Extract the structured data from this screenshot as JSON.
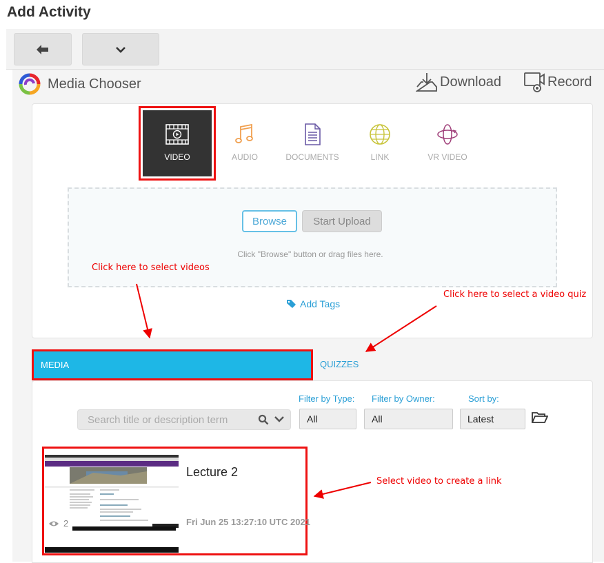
{
  "page": {
    "title": "Add Activity"
  },
  "header": {
    "brand": "Media Chooser",
    "download_label": "Download",
    "record_label": "Record"
  },
  "media_types": [
    {
      "label": "VIDEO",
      "icon": "video-icon",
      "selected": true
    },
    {
      "label": "AUDIO",
      "icon": "music-note-icon",
      "color": "#f0a050"
    },
    {
      "label": "DOCUMENTS",
      "icon": "document-icon",
      "color": "#6a5aa6"
    },
    {
      "label": "LINK",
      "icon": "globe-icon",
      "color": "#c8c43a"
    },
    {
      "label": "VR VIDEO",
      "icon": "vr-icon",
      "color": "#a0407a"
    }
  ],
  "upload": {
    "browse_label": "Browse",
    "start_upload_label": "Start Upload",
    "hint": "Click \"Browse\" button or drag files here.",
    "add_tags_label": "Add Tags"
  },
  "annotations": {
    "select_videos": "Click here to select videos",
    "select_quiz": "Click here to select a video quiz",
    "select_link": "Select video to create a link"
  },
  "tabs": [
    {
      "label": "MEDIA",
      "active": true
    },
    {
      "label": "QUIZZES",
      "active": false
    }
  ],
  "filters": {
    "search_placeholder": "Search title or description term",
    "type_label": "Filter by Type:",
    "type_value": "All",
    "owner_label": "Filter by Owner:",
    "owner_value": "All",
    "sort_label": "Sort by:",
    "sort_value": "Latest"
  },
  "media_items": [
    {
      "title": "Lecture 2",
      "date": "Fri Jun 25 13:27:10 UTC 2021",
      "views": "2"
    }
  ],
  "colors": {
    "accent": "#1eb7e6",
    "annotation_red": "#e00000",
    "link_blue": "#2a9fd6"
  }
}
